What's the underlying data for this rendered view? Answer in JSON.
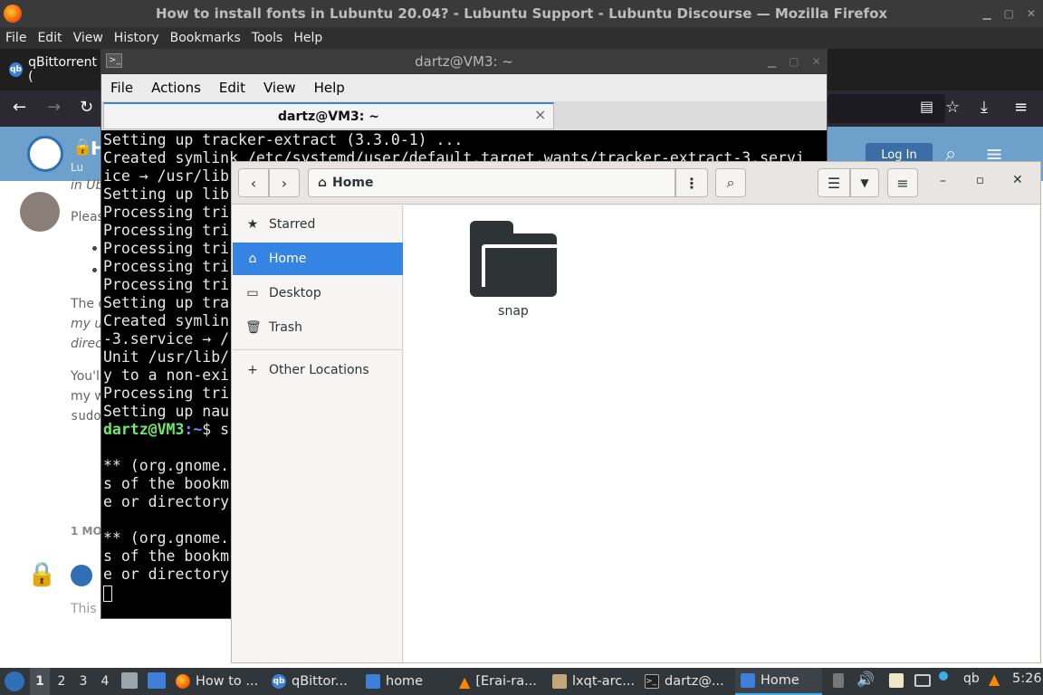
{
  "firefox": {
    "window_title": "How to install fonts in Lubuntu 20.04? - Lubuntu Support - Lubuntu Discourse — Mozilla Firefox",
    "menu": [
      "File",
      "Edit",
      "View",
      "History",
      "Bookmarks",
      "Tools",
      "Help"
    ],
    "tab_label": "qBittorrent (",
    "page": {
      "breadcrumb": "Lu",
      "subtitle": "in Ub",
      "line1": "Pleas",
      "line2": "The d",
      "line3": "my u",
      "line4": "direc",
      "line5": "You'l",
      "line6": "my w",
      "line7": "sudo",
      "line8": "1 MO",
      "line9": "This",
      "login_label": "Log In"
    }
  },
  "terminal": {
    "window_title": "dartz@VM3: ~",
    "menu": [
      "File",
      "Actions",
      "Edit",
      "View",
      "Help"
    ],
    "tab_title": "dartz@VM3: ~",
    "tab_close": "×",
    "lines": [
      "Setting up tracker-extract (3.3.0-1) ...",
      "Created symlink /etc/systemd/user/default.target.wants/tracker-extract-3.servi",
      "ice → /usr/lib",
      "Setting up lib",
      "Processing tri",
      "Processing tri",
      "Processing tri",
      "Processing tri",
      "Processing tri",
      "Setting up tra",
      "Created symlin",
      "-3.service → /",
      "Unit /usr/lib/",
      "y to a non-exi",
      "Processing tri",
      "Setting up nau"
    ],
    "prompt_user": "dartz@VM3",
    "prompt_path": ":~",
    "prompt_rest": "$ s",
    "after_lines": [
      "",
      "** (org.gnome.",
      "s of the bookm",
      "e or directory",
      "",
      "** (org.gnome.",
      "s of the bookm",
      "e or directory"
    ]
  },
  "files": {
    "path_label": "Home",
    "sidebar": [
      {
        "label": "Starred",
        "icon": "star-icon"
      },
      {
        "label": "Home",
        "icon": "home-icon",
        "active": true
      },
      {
        "label": "Desktop",
        "icon": "desktop-icon"
      },
      {
        "label": "Trash",
        "icon": "trash-icon"
      },
      {
        "label": "Other Locations",
        "icon": "plus-icon"
      }
    ],
    "folder_name": "snap"
  },
  "taskbar": {
    "desktops": [
      "1",
      "2",
      "3",
      "4"
    ],
    "tasks": [
      {
        "label": "How to ...",
        "icon": "firefox-icon"
      },
      {
        "label": "qBittor...",
        "icon": "qbittorrent-icon"
      },
      {
        "label": "home",
        "icon": "folder-icon"
      },
      {
        "label": "[Erai-ra...",
        "icon": "vlc-icon"
      },
      {
        "label": "lxqt-arc...",
        "icon": "archive-icon"
      },
      {
        "label": "dartz@...",
        "icon": "terminal-icon"
      },
      {
        "label": "Home",
        "icon": "files-icon",
        "active": true
      }
    ],
    "clock": "5:26",
    "tray_qb": "qb"
  },
  "colors": {
    "accent": "#3584e4",
    "terminal_bg": "#000000",
    "taskbar_bg": "#31363b",
    "prompt_user": "#6fe86f",
    "prompt_path": "#6c8cff"
  }
}
